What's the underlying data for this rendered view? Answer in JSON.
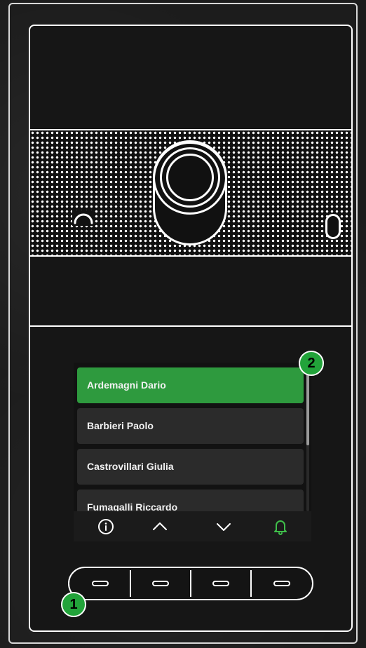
{
  "names_list": {
    "items": [
      {
        "label": "Ardemagni Dario",
        "selected": true
      },
      {
        "label": "Barbieri Paolo",
        "selected": false
      },
      {
        "label": "Castrovillari Giulia",
        "selected": false
      },
      {
        "label": "Fumagalli Riccardo",
        "selected": false
      }
    ]
  },
  "screen_nav": {
    "info_icon": "info-circle-icon",
    "up_icon": "chevron-up-icon",
    "down_icon": "chevron-down-icon",
    "call_icon": "bell-icon"
  },
  "keypad": {
    "keys": [
      "key-1",
      "key-2",
      "key-3",
      "key-4"
    ]
  },
  "callouts": {
    "keypad_badge": "1",
    "screen_badge": "2"
  },
  "colors": {
    "accent": "#2e9a3e",
    "badge": "#22a33a",
    "list_item": "#2b2b2b",
    "panel_outline": "#ffffff"
  }
}
